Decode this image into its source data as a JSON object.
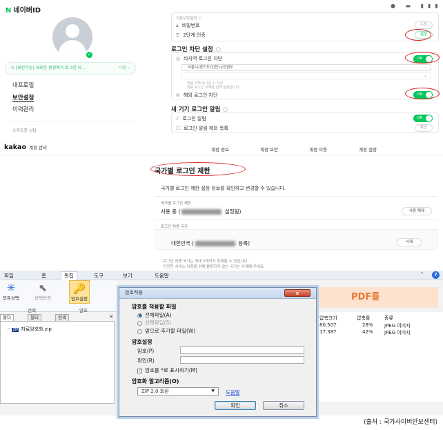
{
  "naver": {
    "logo_mark": "N",
    "logo_text": "네이버ID",
    "top_icons": "● ▬ ▮▮▮",
    "notice": "[보안기능] 새로운 환경에서 로그인 되...",
    "notice_arrow": "이동",
    "menu": [
      "내프로필",
      "보안설정",
      "이력관리"
    ],
    "service": "스마트봇 상담",
    "basic_security_title": "기본보안설정",
    "rows": [
      {
        "label": "비밀번호",
        "action": "수정"
      },
      {
        "label": "2단계 인증",
        "action": "설정"
      }
    ],
    "login_block_title": "로그인 차단 설정",
    "region_block_label": "타지역 로그인 차단",
    "region_block_state": "ON",
    "region_select_value": "서울시/경기도/인천시/강원도",
    "region_hint_1": "허용 지역 로그인 시 차단",
    "region_hint_2": "허용 로그인 지역을 함께 설정합니다.",
    "overseas_block_label": "해외 로그인 차단",
    "overseas_block_state": "ON",
    "new_device_title": "새 기기 로그인 알림",
    "login_alert_label": "로그인 알림",
    "login_alert_state": "ON",
    "alert_exclude_label": "로그인 알림 제외 목록",
    "alert_exclude_action": "확인"
  },
  "kakao": {
    "brand": "kakao",
    "brand_sub": "계정 관리",
    "nav": [
      "계정 정보",
      "계정 보안",
      "계정 이용",
      "계정 설정"
    ],
    "title": "국가별 로그인 제한",
    "description": "국가별 로그인 제한 설정 정보를 확인하고 변경할 수 있습니다.",
    "restriction_label": "국가별 로그인 제한",
    "restriction_value_prefix": "사용 중 (",
    "restriction_value_suffix": " 설정됨)",
    "restriction_button": "사용 해제",
    "allowed_label": "로그인 허용 국가",
    "allowed_value_prefix": "대한민국 (",
    "allowed_value_suffix": " 등록)",
    "allowed_button": "삭제",
    "notes": [
      "· 로그인 허용 국가는 최대 3개까지 등록할 수 있습니다.",
      "· 안전한 서비스 이용을 위해 활동하지 않는 국가는 삭제해 주세요."
    ]
  },
  "zip": {
    "menus": [
      "파일",
      "홈",
      "편집",
      "도구",
      "보기",
      "도움말"
    ],
    "active_menu": "편집",
    "tools": [
      {
        "label": "모두선택",
        "glyph": "✳"
      },
      {
        "label": "선택반전",
        "glyph": "⬉"
      },
      {
        "label": "암호설정",
        "glyph": "🔑"
      }
    ],
    "groups": [
      "선택",
      "암호"
    ],
    "side_tabs": [
      "폴더",
      "필터",
      "검색"
    ],
    "close_glyph": "×",
    "tree_item_icon": "ZIP",
    "tree_item": "자료암호화.zip",
    "pdf_banner": "PDF를",
    "list_headers": [
      "압축크기",
      "압축률",
      "종류"
    ],
    "list_rows": [
      {
        "size": "80,507",
        "ratio": "28%",
        "type": "JPEG 이미지"
      },
      {
        "size": "17,387",
        "ratio": "42%",
        "type": "JPEG 이미지"
      }
    ],
    "dialog": {
      "title": "암호적용",
      "close": "x",
      "apply_section": "암호를 적용할 파일",
      "options": [
        "전체파일(A)",
        "선택파일(S)",
        "앞으로 추가할 파일(W)"
      ],
      "password_section": "암호설정",
      "password_label": "암호(P)",
      "confirm_label": "확인(R)",
      "show_stars": "암호를 *로 표시하기(M)",
      "algorithm_section": "암호화 알고리즘(O)",
      "algorithm_value": "ZIP 2.0 호환",
      "help_link": "도움말",
      "ok": "확인",
      "cancel": "취소"
    }
  },
  "source": "(출처 : 국가사이버안보센터)"
}
